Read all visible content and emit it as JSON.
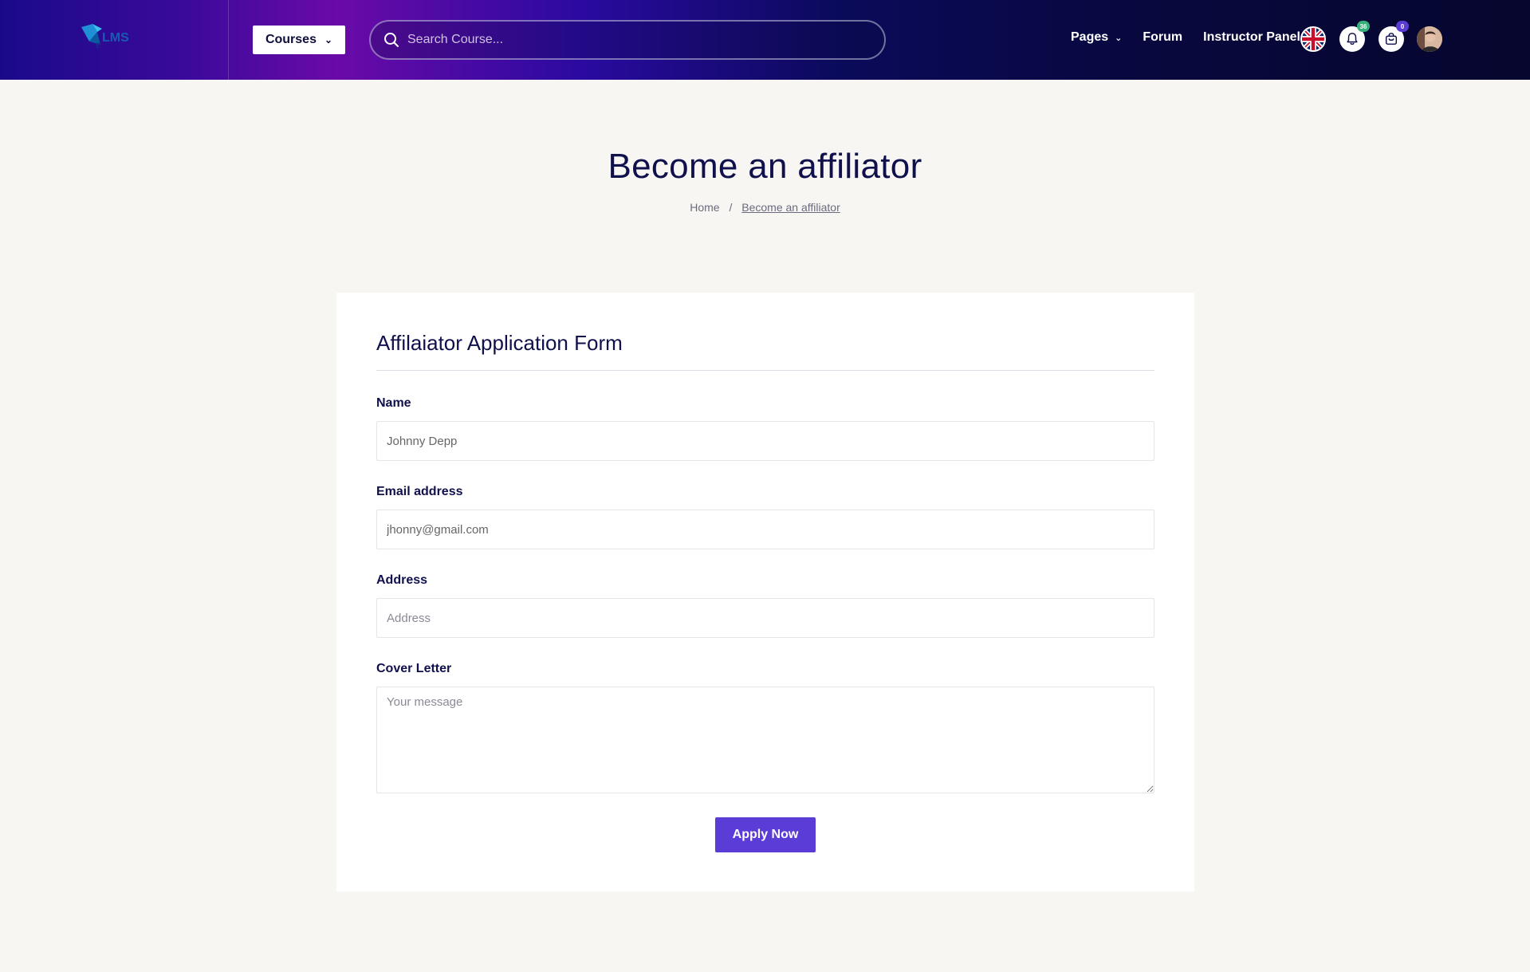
{
  "header": {
    "courses_label": "Courses",
    "search_placeholder": "Search Course...",
    "nav": [
      {
        "label": "Pages",
        "has_dropdown": true
      },
      {
        "label": "Forum",
        "has_dropdown": false
      },
      {
        "label": "Instructor Panel",
        "has_dropdown": false
      }
    ],
    "notification_count": "36",
    "cart_count": "0",
    "language_icon": "uk-flag-icon"
  },
  "page": {
    "title": "Become an affiliator",
    "breadcrumb": {
      "home": "Home",
      "separator": "/",
      "current": "Become an affiliator"
    }
  },
  "form": {
    "title": "Affilaiator Application Form",
    "name_label": "Name",
    "name_value": "Johnny Depp",
    "email_label": "Email address",
    "email_value": "jhonny@gmail.com",
    "address_label": "Address",
    "address_placeholder": "Address",
    "cover_label": "Cover Letter",
    "cover_placeholder": "Your message",
    "submit_label": "Apply Now"
  },
  "colors": {
    "accent": "#5b3cd6",
    "heading": "#10104d",
    "background": "#f8f6f2",
    "notification_badge": "#35b07a"
  }
}
